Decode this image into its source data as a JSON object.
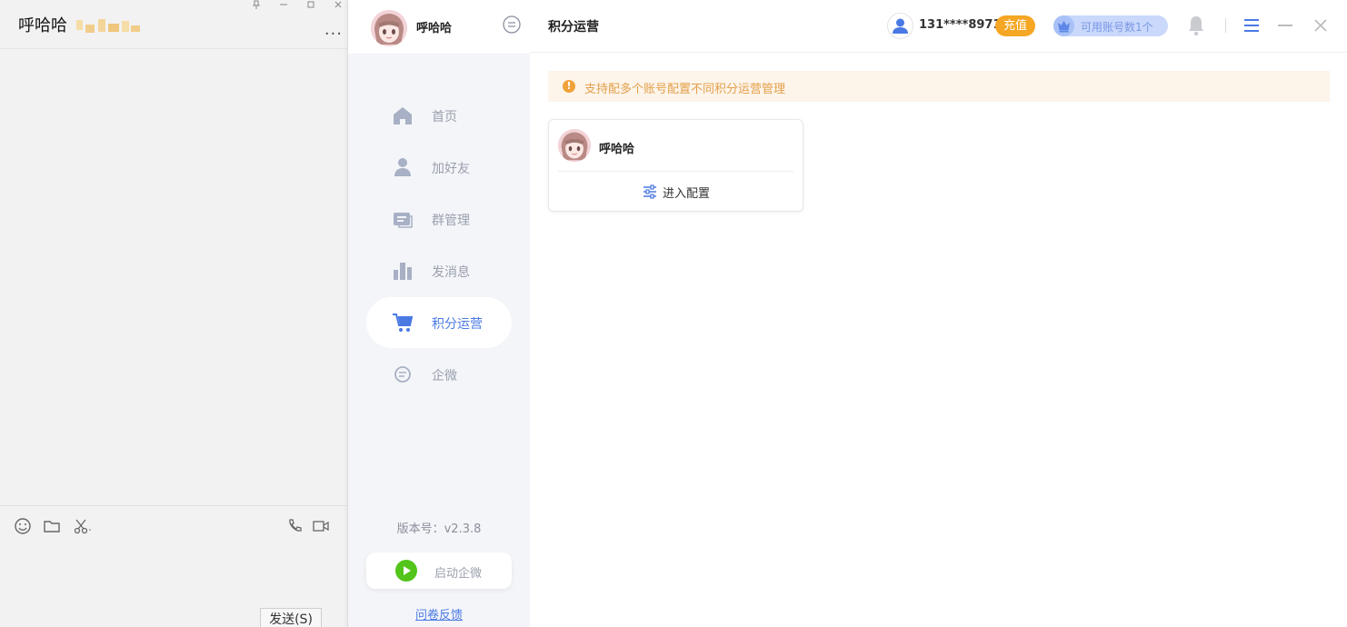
{
  "chat": {
    "title": "呼哈哈",
    "window_controls": [
      "pin-icon",
      "minimize-icon",
      "maximize-icon",
      "close-icon"
    ],
    "more": "...",
    "toolbar_icons": [
      "emoji-icon",
      "folder-icon",
      "scissors-icon",
      "phone-icon",
      "video-icon"
    ],
    "send_label": "发送(S)"
  },
  "sidebar": {
    "user_name": "呼哈哈",
    "items": [
      {
        "label": "首页",
        "icon": "home-icon",
        "active": false
      },
      {
        "label": "加好友",
        "icon": "user-icon",
        "active": false
      },
      {
        "label": "群管理",
        "icon": "group-icon",
        "active": false
      },
      {
        "label": "发消息",
        "icon": "bar-chart-icon",
        "active": false
      },
      {
        "label": "积分运营",
        "icon": "cart-icon",
        "active": true
      },
      {
        "label": "企微",
        "icon": "chat-bubble-icon",
        "active": false
      }
    ],
    "version": "版本号：v2.3.8",
    "launch_label": "启动企微",
    "feedback_label": "问卷反馈"
  },
  "header": {
    "page_title": "积分运营",
    "phone": "131****8971",
    "recharge_label": "充值",
    "accounts_label": "可用账号数1个"
  },
  "notice": {
    "text": "支持配多个账号配置不同积分运营管理"
  },
  "cards": [
    {
      "name": "呼哈哈",
      "action_label": "进入配置"
    }
  ],
  "colors": {
    "accent": "#4a79e4",
    "recharge": "#f5a623",
    "notice_bg": "#fdf4ea",
    "notice_text": "#e3a04a",
    "launch_green": "#52c41a"
  }
}
